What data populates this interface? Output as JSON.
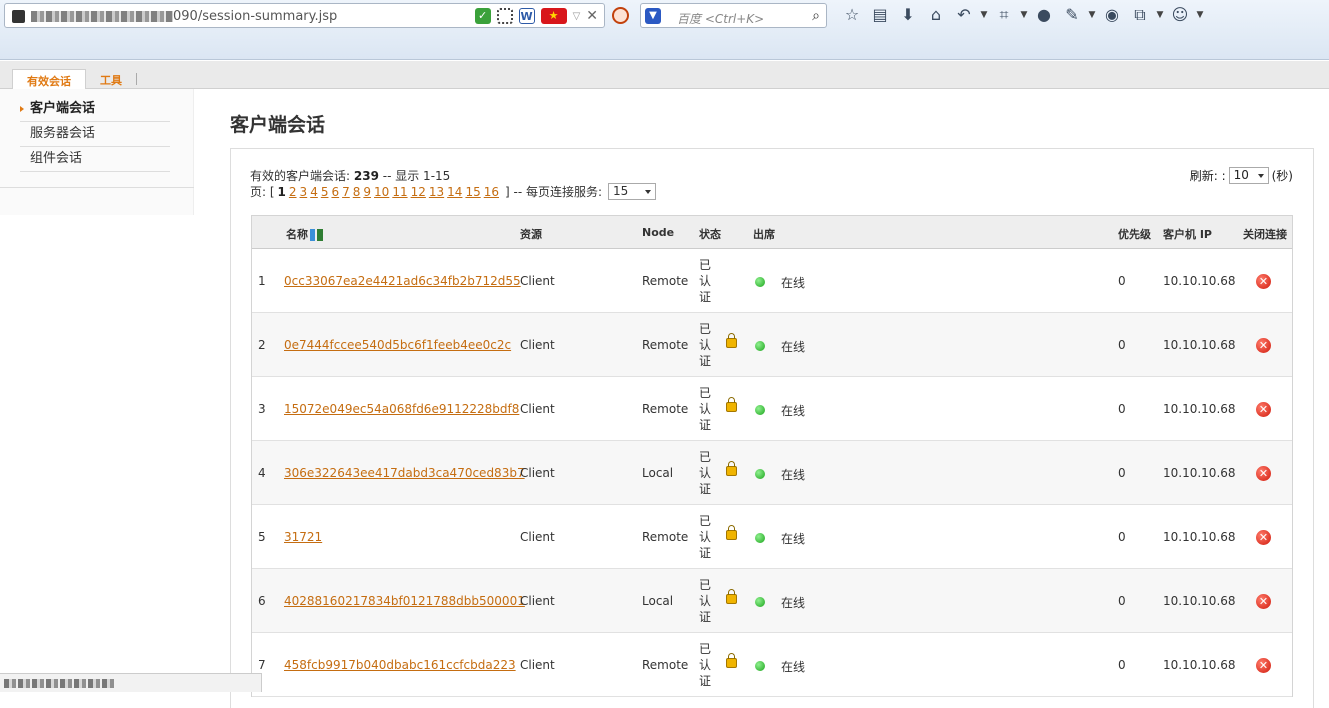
{
  "browser": {
    "url_visible": "090/session-summary.jsp",
    "search_placeholder": "百度 <Ctrl+K>"
  },
  "tabs": [
    {
      "label": "有效会话",
      "active": true
    },
    {
      "label": "工具",
      "active": false
    }
  ],
  "sidebar": {
    "items": [
      {
        "label": "客户端会话",
        "active": true
      },
      {
        "label": "服务器会话",
        "active": false
      },
      {
        "label": "组件会话",
        "active": false
      }
    ]
  },
  "main": {
    "title": "客户端会话",
    "summary_prefix": "有效的客户端会话:",
    "summary_count": "239",
    "summary_suffix": "-- 显示 1-15",
    "pager_prefix": "页: [",
    "pages": [
      "1",
      "2",
      "3",
      "4",
      "5",
      "6",
      "7",
      "8",
      "9",
      "10",
      "11",
      "12",
      "13",
      "14",
      "15",
      "16"
    ],
    "current_page": "1",
    "pager_suffix": "] -- 每页连接服务:",
    "page_size": "15",
    "refresh_label": "刷新: :",
    "refresh_value": "10",
    "refresh_unit": "(秒)"
  },
  "table": {
    "headers": {
      "name": "名称",
      "resource": "资源",
      "node": "Node",
      "state": "状态",
      "presence": "出席",
      "priority": "优先级",
      "client_ip": "客户机 IP",
      "close": "关闭连接"
    },
    "rows": [
      {
        "index": "1",
        "name": "0cc33067ea2e4421ad6c34fb2b712d55",
        "resource": "Client",
        "node": "Remote",
        "state": "已认证",
        "locked": false,
        "presence": "在线",
        "priority": "0",
        "ip": "10.10.10.68"
      },
      {
        "index": "2",
        "name": "0e7444fccee540d5bc6f1feeb4ee0c2c",
        "resource": "Client",
        "node": "Remote",
        "state": "已认证",
        "locked": true,
        "presence": "在线",
        "priority": "0",
        "ip": "10.10.10.68"
      },
      {
        "index": "3",
        "name": "15072e049ec54a068fd6e9112228bdf8",
        "resource": "Client",
        "node": "Remote",
        "state": "已认证",
        "locked": true,
        "presence": "在线",
        "priority": "0",
        "ip": "10.10.10.68"
      },
      {
        "index": "4",
        "name": "306e322643ee417dabd3ca470ced83b7",
        "resource": "Client",
        "node": "Local",
        "state": "已认证",
        "locked": true,
        "presence": "在线",
        "priority": "0",
        "ip": "10.10.10.68"
      },
      {
        "index": "5",
        "name": "31721",
        "resource": "Client",
        "node": "Remote",
        "state": "已认证",
        "locked": true,
        "presence": "在线",
        "priority": "0",
        "ip": "10.10.10.68"
      },
      {
        "index": "6",
        "name": "40288160217834bf0121788dbb500001",
        "resource": "Client",
        "node": "Local",
        "state": "已认证",
        "locked": true,
        "presence": "在线",
        "priority": "0",
        "ip": "10.10.10.68"
      },
      {
        "index": "7",
        "name": "458fcb9917b040dbabc161ccfcbda223",
        "resource": "Client",
        "node": "Remote",
        "state": "已认证",
        "locked": true,
        "presence": "在线",
        "priority": "0",
        "ip": "10.10.10.68"
      }
    ]
  },
  "colors": {
    "accent": "#e07a14",
    "link": "#c56d11",
    "online": "#1ca41c",
    "close": "#d01a0c"
  },
  "icons": {
    "sort": "sort-ascending-icon",
    "lock": "lock-icon",
    "presence": "online-dot-icon",
    "close": "close-icon"
  }
}
